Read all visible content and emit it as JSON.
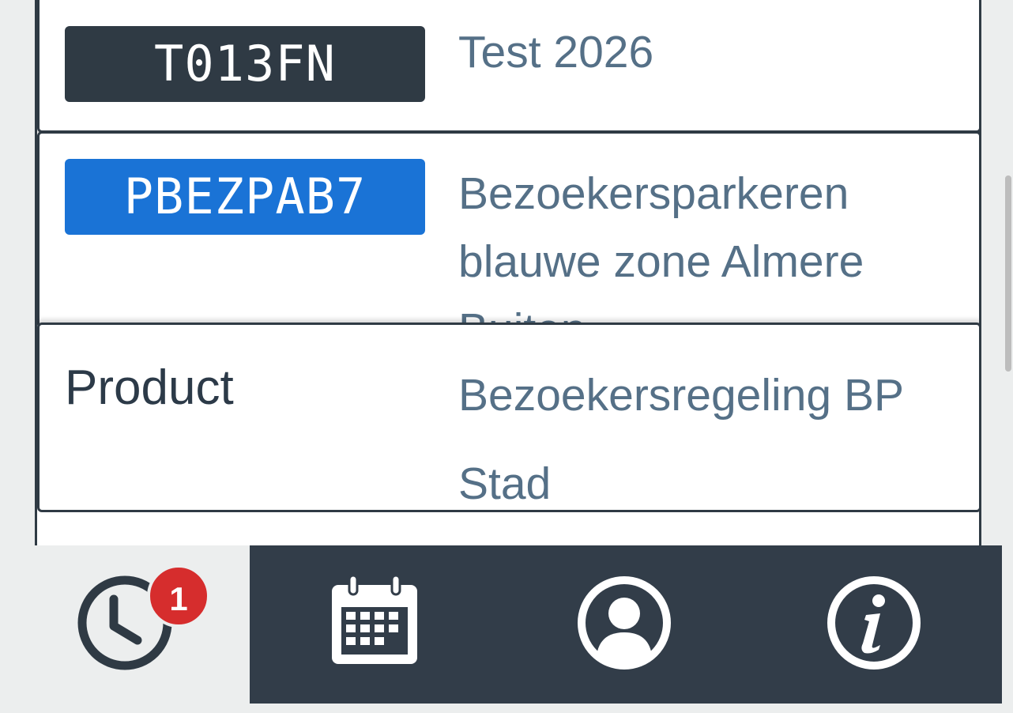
{
  "parkings": [
    {
      "plate": "T013FN",
      "zone": "Test 2026"
    },
    {
      "plate": "PBEZPAB7",
      "zone": "Bezoekersparkeren blauwe zone Almere Buiten"
    }
  ],
  "product": {
    "label": "Product",
    "value": "Bezoekersregeling BP Stad"
  },
  "tabs": [
    {
      "icon": "clock-icon",
      "badge": "1",
      "active": true
    },
    {
      "icon": "calendar-icon",
      "active": false
    },
    {
      "icon": "user-icon",
      "active": false
    },
    {
      "icon": "info-icon",
      "active": false
    }
  ],
  "colors": {
    "plate_dark": "#2f3a44",
    "plate_blue": "#1a73d6",
    "badge_red": "#d62d2d",
    "tabbar": "#323d49"
  }
}
